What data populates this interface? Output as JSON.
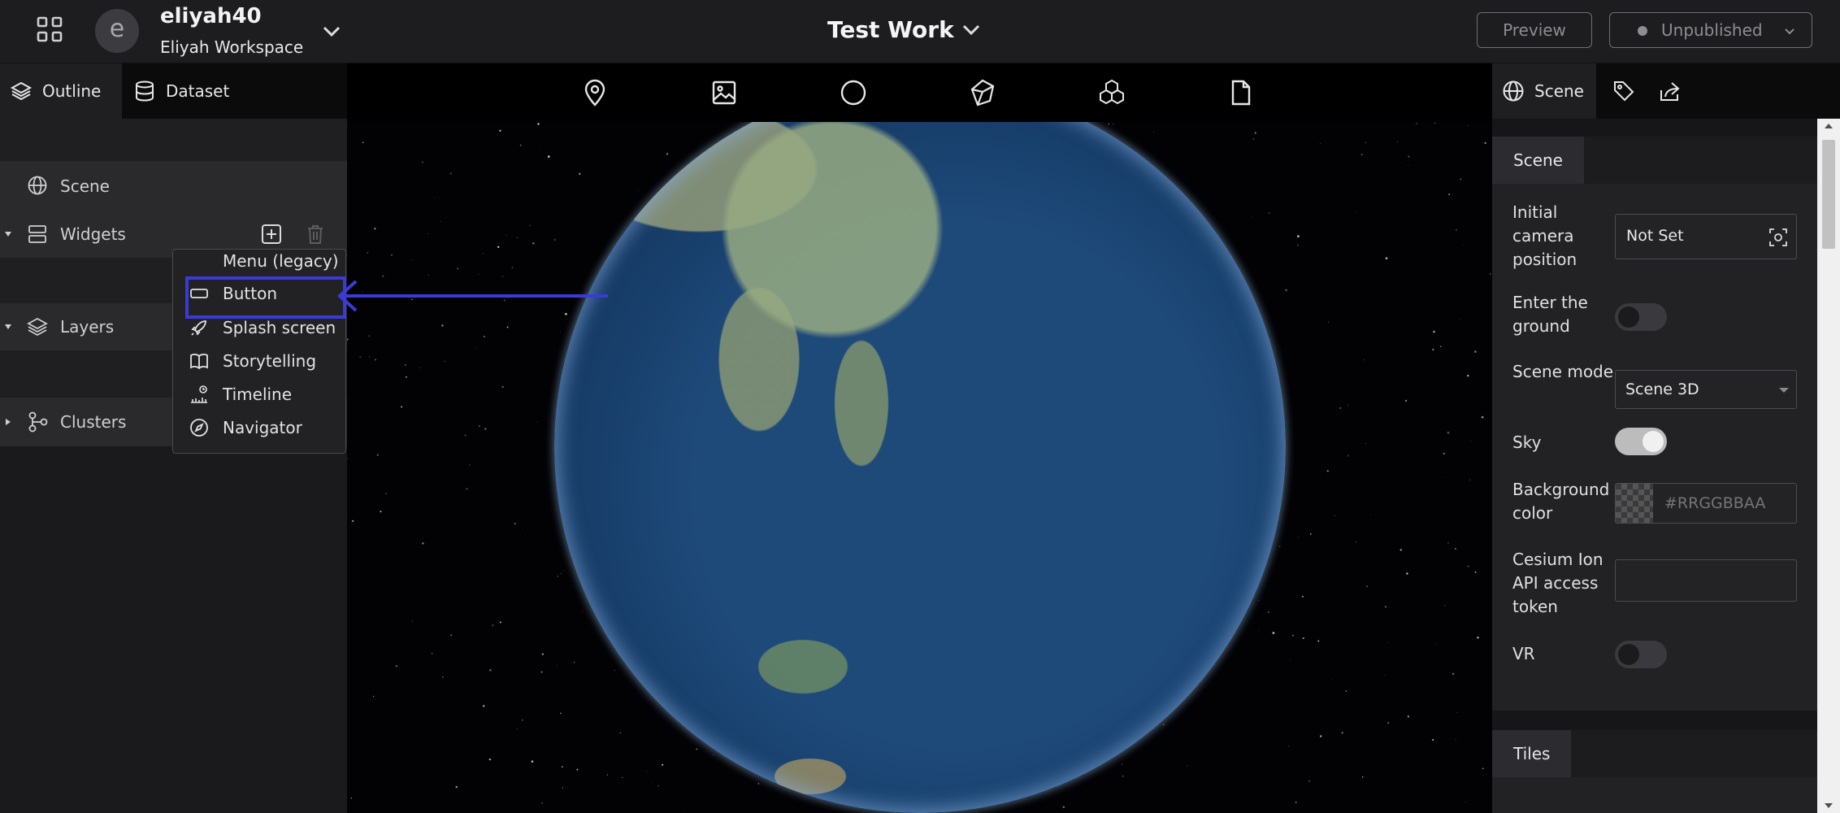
{
  "header": {
    "avatar_letter": "e",
    "user_name": "eliyah40",
    "workspace": "Eliyah Workspace",
    "project_title": "Test Work",
    "preview_label": "Preview",
    "publish_status": "Unpublished"
  },
  "left_panel": {
    "tabs": [
      {
        "label": "Outline",
        "icon": "layers-icon",
        "active": true
      },
      {
        "label": "Dataset",
        "icon": "database-icon",
        "active": false
      }
    ],
    "tree": {
      "scene": "Scene",
      "widgets": "Widgets",
      "layers": "Layers",
      "clusters": "Clusters"
    },
    "widget_menu": [
      {
        "label": "Menu (legacy)",
        "icon": "menu-icon"
      },
      {
        "label": "Button",
        "icon": "button-icon",
        "highlighted": true
      },
      {
        "label": "Splash screen",
        "icon": "rocket-icon"
      },
      {
        "label": "Storytelling",
        "icon": "book-icon"
      },
      {
        "label": "Timeline",
        "icon": "timeline-icon"
      },
      {
        "label": "Navigator",
        "icon": "compass-icon"
      }
    ]
  },
  "toolbar": {
    "tools": [
      "map-pin-icon",
      "image-icon",
      "circle-icon",
      "box-icon",
      "cubes-icon",
      "file-icon"
    ]
  },
  "right_panel": {
    "tabs": [
      {
        "label": "Scene",
        "icon": "globe-icon",
        "active": true
      },
      {
        "label": "",
        "icon": "tag-icon"
      },
      {
        "label": "",
        "icon": "share-icon"
      }
    ],
    "scene_section": {
      "title": "Scene",
      "initial_camera_label": "Initial camera position",
      "initial_camera_value": "Not Set",
      "enter_ground_label": "Enter the ground",
      "enter_ground_on": false,
      "scene_mode_label": "Scene mode",
      "scene_mode_value": "Scene 3D",
      "sky_label": "Sky",
      "sky_on": true,
      "bg_color_label": "Background color",
      "bg_color_placeholder": "#RRGGBBAA",
      "cesium_label": "Cesium Ion API access token",
      "cesium_value": "",
      "vr_label": "VR",
      "vr_on": false
    },
    "tiles_section": {
      "title": "Tiles"
    }
  },
  "colors": {
    "highlight": "#3a3ad8",
    "panel_bg": "#1a1a1c",
    "topbar_bg": "#1d1d20"
  }
}
